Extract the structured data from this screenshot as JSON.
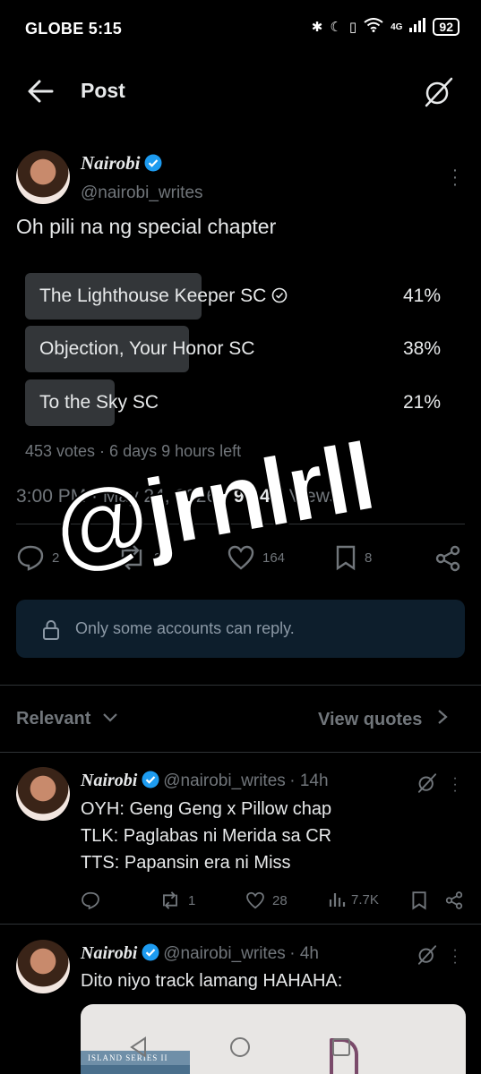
{
  "status_bar": {
    "time": "GLOBE 5:15",
    "network": "4G",
    "battery": "92"
  },
  "header": {
    "title": "Post",
    "back_icon": "arrow-left-icon",
    "grok_icon": "grok-icon"
  },
  "post": {
    "author_name": "Nairobi",
    "author_handle": "@nairobi_writes",
    "text": "Oh pili na ng special chapter",
    "poll": {
      "options": [
        {
          "label": "The Lighthouse Keeper SC",
          "percent": "41%",
          "fraction": 0.41
        },
        {
          "label": "Objection, Your Honor SC",
          "percent": "38%",
          "fraction": 0.38
        },
        {
          "label": "To the Sky SC",
          "percent": "21%",
          "fraction": 0.21
        }
      ],
      "meta": "453 votes · 6 days 9 hours left"
    },
    "time": "3:00 PM",
    "date": "May 24, 2026",
    "views_count": "99.4K",
    "views_label": "Views",
    "stats": {
      "replies": "2",
      "reposts": "32",
      "likes": "164",
      "bookmarks": "8"
    },
    "reply_restriction": "Only some accounts can reply."
  },
  "watermark": "@jrnlrll",
  "sort": {
    "label": "Relevant",
    "view_quotes": "View quotes"
  },
  "replies": [
    {
      "author_name": "Nairobi",
      "author_handle": "@nairobi_writes",
      "time": "14h",
      "lines": [
        "OYH: Geng Geng x Pillow chap",
        "TLK: Paglabas ni Merida sa CR",
        "TTS: Papansin era ni Miss"
      ],
      "stats": {
        "replies": "",
        "reposts": "1",
        "likes": "28",
        "views": "7.7K"
      }
    },
    {
      "author_name": "Nairobi",
      "author_handle": "@nairobi_writes",
      "time": "4h",
      "lines": [
        "Dito niyo track lamang HAHAHA:"
      ],
      "image_caption": "ISLAND SERIES II"
    }
  ],
  "colors": {
    "accent": "#1d9bf0",
    "background": "#000000",
    "muted": "#71767b",
    "poll_bar": "#333639"
  }
}
